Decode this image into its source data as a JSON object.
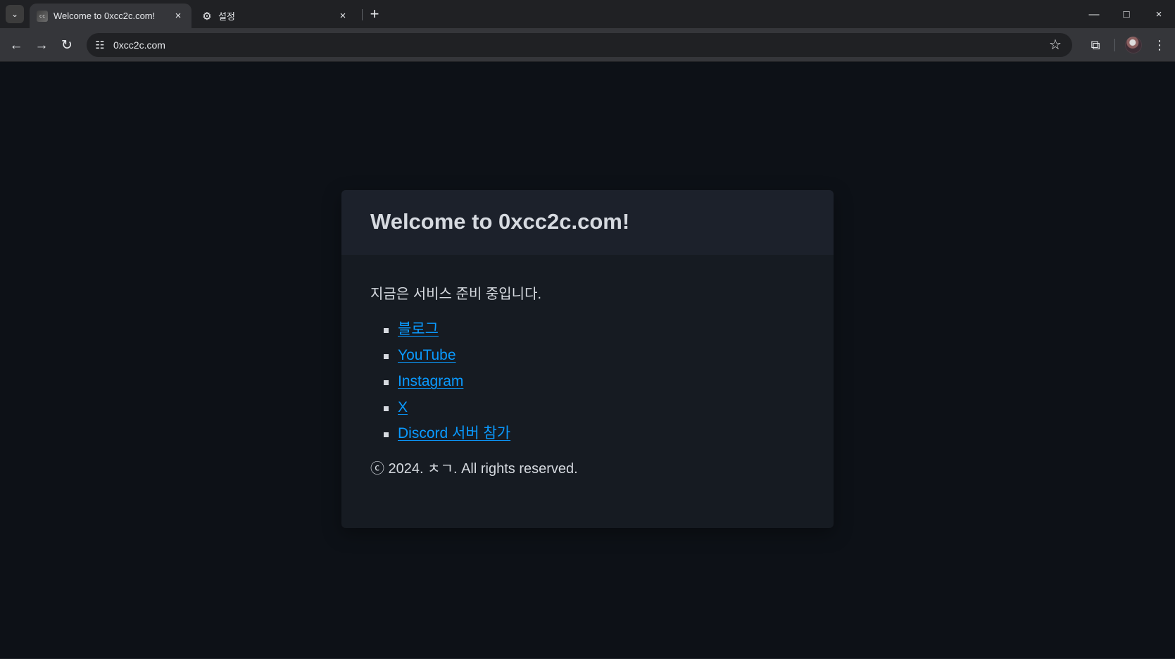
{
  "browser": {
    "tabs": [
      {
        "title": "Welcome to 0xcc2c.com!",
        "favicon": "0xcc2c-favicon-icon",
        "active": true
      },
      {
        "title": "설정",
        "favicon": "gear-icon",
        "active": false
      }
    ],
    "icons": {
      "tab_search": "⌄",
      "close": "×",
      "new_tab": "+",
      "minimize": "—",
      "maximize": "□",
      "window_close": "×",
      "back": "←",
      "forward": "→",
      "reload": "↻",
      "site_info": "☷",
      "bookmark": "☆",
      "extensions": "⧉",
      "menu": "⋮"
    },
    "address_bar": {
      "url": "0xcc2c.com"
    }
  },
  "page": {
    "title": "Welcome to 0xcc2c.com!",
    "status": "지금은 서비스 준비 중입니다.",
    "links": [
      {
        "label": "블로그"
      },
      {
        "label": "YouTube"
      },
      {
        "label": "Instagram"
      },
      {
        "label": "X"
      },
      {
        "label": "Discord 서버 참가"
      }
    ],
    "copyright": "ⓒ 2024. ㅊㄱ. All rights reserved."
  },
  "colors": {
    "page_background": "#0d1117",
    "card_background": "#161b22",
    "card_header_background": "#1c212b",
    "text": "#d6dae0",
    "link": "#0a9aff",
    "browser_frame": "#202124",
    "browser_toolbar": "#35363a"
  }
}
